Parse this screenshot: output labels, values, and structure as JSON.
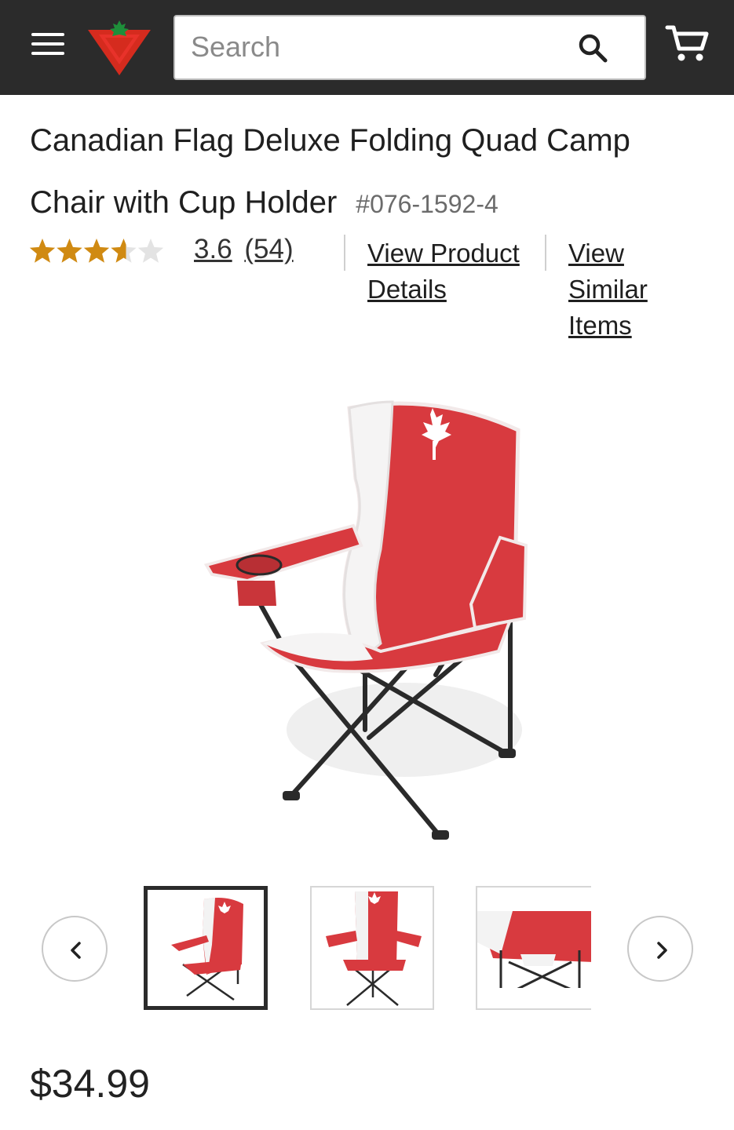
{
  "header": {
    "menu_icon": "hamburger-menu-icon",
    "logo_icon": "canadian-tire-triangle-logo",
    "search": {
      "placeholder": "Search",
      "value": ""
    },
    "search_icon": "search-icon",
    "cart_icon": "cart-icon"
  },
  "product": {
    "title": "Canadian Flag Deluxe Folding Quad Camp Chair with Cup Holder",
    "sku": "#076-1592-4",
    "rating_value": "3.6",
    "review_count": "(54)",
    "stars_filled": 3.6,
    "stars_total": 5,
    "view_details_label": "View Product Details",
    "view_similar_label": "View Similar Items",
    "price": "$34.99"
  },
  "gallery": {
    "prev_icon": "chevron-left-icon",
    "next_icon": "chevron-right-icon",
    "selected_index": 0,
    "thumbnails": [
      "chair-front-angle",
      "chair-front",
      "chair-seat-closeup"
    ]
  },
  "colors": {
    "header_bg": "#2b2b2b",
    "brand_red": "#d52b1e",
    "chair_red": "#d83a3f",
    "star_gold": "#d08a12",
    "leaf_green": "#1e8f3a"
  }
}
